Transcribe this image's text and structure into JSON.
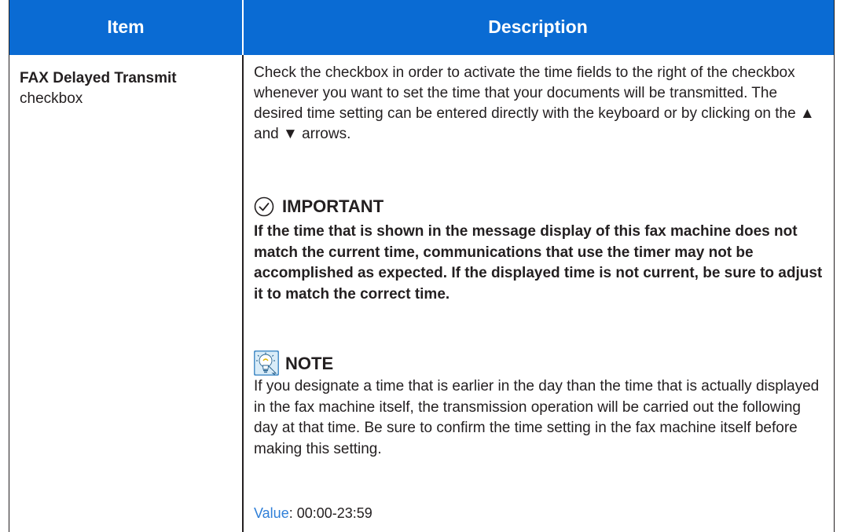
{
  "header": {
    "item_label": "Item",
    "description_label": "Description"
  },
  "colors": {
    "header_bg": "#0a6bd3",
    "value_label": "#2f7fd8",
    "note_icon_bg": "#4a8fc8"
  },
  "row": {
    "item_name": "FAX Delayed Transmit",
    "item_kind": "checkbox",
    "description": "Check the checkbox in order to activate the time fields to the right of the checkbox whenever you want to set the time that your documents will be transmitted. The desired time setting can be entered directly with the keyboard or by clicking on the ▲ and ▼ arrows.",
    "important": {
      "icon": "checkmark-circle-icon",
      "title": "IMPORTANT",
      "body": "If the time that is shown in the message display of this fax machine does not match the current time, communications that use the timer may not be accomplished as expected. If the displayed time is not current, be sure to adjust it to match the correct time."
    },
    "note": {
      "icon": "lightbulb-icon",
      "title": "NOTE",
      "body": "If you designate a time that is earlier in the day than the time that is actually displayed in the fax machine itself, the transmission operation will be carried out the following day at that time. Be sure to confirm the time setting in the fax machine itself before making this setting."
    },
    "value_label": "Value",
    "value_text": ": 00:00-23:59"
  }
}
